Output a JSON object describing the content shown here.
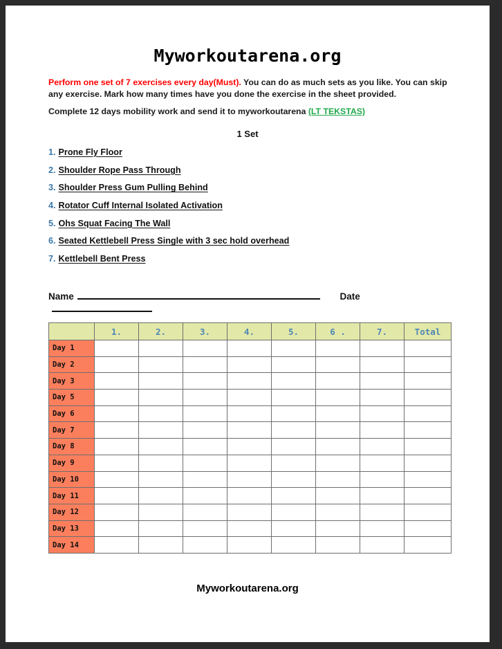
{
  "document": {
    "title": "Myworkoutarena.org",
    "footer_brand": "Myworkoutarena.org"
  },
  "intro": {
    "lead_red": "Perform one set of 7 exercises every day(Must).",
    "body_rest": " You can do as much sets as you like. You can skip any exercise. Mark how many times have you done the exercise in the sheet provided.",
    "second_line": "Complete 12 days mobility work and send it to myworkoutarena ",
    "link_text": "(LT TEKSTAS)"
  },
  "set_label": "1 Set",
  "exercises": [
    {
      "num": "1.",
      "name": "Prone Fly Floor"
    },
    {
      "num": "2.",
      "name": "Shoulder Rope Pass Through"
    },
    {
      "num": "3.",
      "name": "Shoulder Press Gum Pulling Behind"
    },
    {
      "num": "4.",
      "name": "Rotator Cuff Internal Isolated Activation"
    },
    {
      "num": "5.",
      "name": "Ohs Squat Facing The Wall"
    },
    {
      "num": "6.",
      "name": "Seated Kettlebell Press Single with 3 sec hold overhead"
    },
    {
      "num": "7.",
      "name": "Kettlebell Bent Press"
    }
  ],
  "form_fields": {
    "name_label": "Name",
    "name_value": "",
    "date_label": "Date",
    "date_value": ""
  },
  "tracker": {
    "corner_header": "",
    "column_headers": [
      "1.",
      "2.",
      "3.",
      "4.",
      "5.",
      "6 .",
      "7.",
      "Total"
    ],
    "rows": [
      {
        "day": "Day  1",
        "cells": [
          "",
          "",
          "",
          "",
          "",
          "",
          "",
          ""
        ]
      },
      {
        "day": "Day  2",
        "cells": [
          "",
          "",
          "",
          "",
          "",
          "",
          "",
          ""
        ]
      },
      {
        "day": "Day  3",
        "cells": [
          "",
          "",
          "",
          "",
          "",
          "",
          "",
          ""
        ]
      },
      {
        "day": "Day  5",
        "cells": [
          "",
          "",
          "",
          "",
          "",
          "",
          "",
          ""
        ]
      },
      {
        "day": "Day  6",
        "cells": [
          "",
          "",
          "",
          "",
          "",
          "",
          "",
          ""
        ]
      },
      {
        "day": "Day  7",
        "cells": [
          "",
          "",
          "",
          "",
          "",
          "",
          "",
          ""
        ]
      },
      {
        "day": "Day  8",
        "cells": [
          "",
          "",
          "",
          "",
          "",
          "",
          "",
          ""
        ]
      },
      {
        "day": "Day  9",
        "cells": [
          "",
          "",
          "",
          "",
          "",
          "",
          "",
          ""
        ]
      },
      {
        "day": "Day  10",
        "cells": [
          "",
          "",
          "",
          "",
          "",
          "",
          "",
          ""
        ]
      },
      {
        "day": "Day  11",
        "cells": [
          "",
          "",
          "",
          "",
          "",
          "",
          "",
          ""
        ]
      },
      {
        "day": "Day  12",
        "cells": [
          "",
          "",
          "",
          "",
          "",
          "",
          "",
          ""
        ]
      },
      {
        "day": "Day  13",
        "cells": [
          "",
          "",
          "",
          "",
          "",
          "",
          "",
          ""
        ]
      },
      {
        "day": "Day  14",
        "cells": [
          "",
          "",
          "",
          "",
          "",
          "",
          "",
          ""
        ]
      }
    ]
  },
  "colors": {
    "page_frame": "#2b2b2b",
    "sheet": "#ffffff",
    "alert_red": "#ff0000",
    "link_green": "#21a84b",
    "number_blue": "#3c78a8",
    "header_green": "#e2e8a8",
    "header_text_blue": "#4f86b5",
    "day_orange": "#fb7f5d",
    "grid_line": "#6e6e6e"
  }
}
